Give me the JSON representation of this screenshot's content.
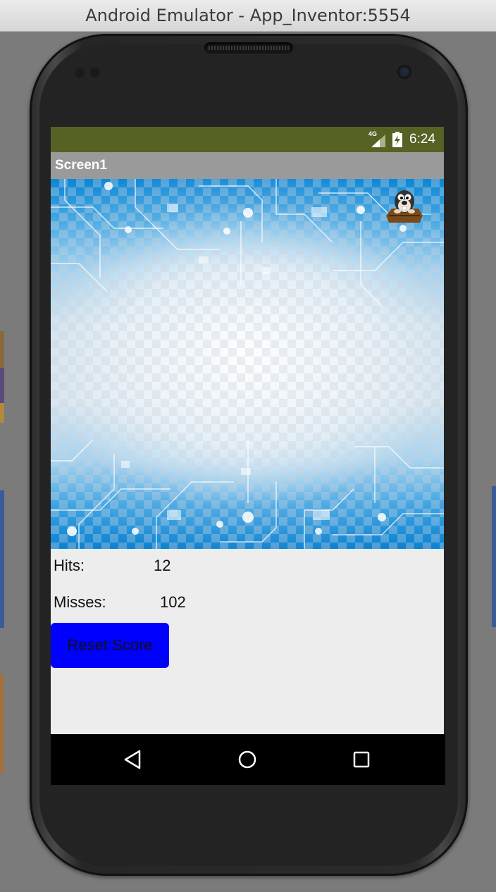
{
  "window": {
    "title": "Android Emulator - App_Inventor:5554"
  },
  "status_bar": {
    "network": "4G",
    "time": "6:24",
    "battery_icon": "battery-charging-icon",
    "signal_icon": "signal-icon"
  },
  "app": {
    "screen_title": "Screen1"
  },
  "score": {
    "hits_label": "Hits:",
    "hits_value": "12",
    "misses_label": "Misses:",
    "misses_value": "102"
  },
  "buttons": {
    "reset_label": "Reset Score"
  },
  "navigation": {
    "back_icon": "back-triangle-icon",
    "home_icon": "home-circle-icon",
    "recents_icon": "recents-square-icon"
  },
  "colors": {
    "status_bar": "#556224",
    "action_bar": "#9a9a9a",
    "reset_button": "#0000ff",
    "screen_background": "#ededed"
  }
}
